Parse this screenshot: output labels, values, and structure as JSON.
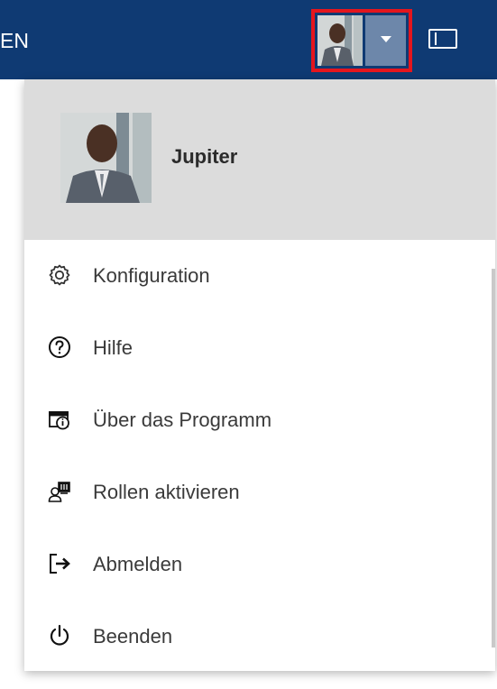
{
  "topbar": {
    "truncated_label": "EN"
  },
  "user": {
    "name": "Jupiter"
  },
  "menu": {
    "items": [
      {
        "label": "Konfiguration",
        "icon": "gear-icon"
      },
      {
        "label": "Hilfe",
        "icon": "help-circle-icon"
      },
      {
        "label": "Über das Programm",
        "icon": "about-info-icon"
      },
      {
        "label": "Rollen aktivieren",
        "icon": "activate-roles-icon"
      },
      {
        "label": "Abmelden",
        "icon": "logout-icon"
      },
      {
        "label": "Beenden",
        "icon": "power-icon"
      }
    ]
  },
  "colors": {
    "topbar_bg": "#0f3a73",
    "highlight_border": "#e4161e",
    "dropdown_part_bg": "#6d87aa",
    "menu_header_bg": "#dcdcdc",
    "menu_text": "#3a3a3a"
  }
}
